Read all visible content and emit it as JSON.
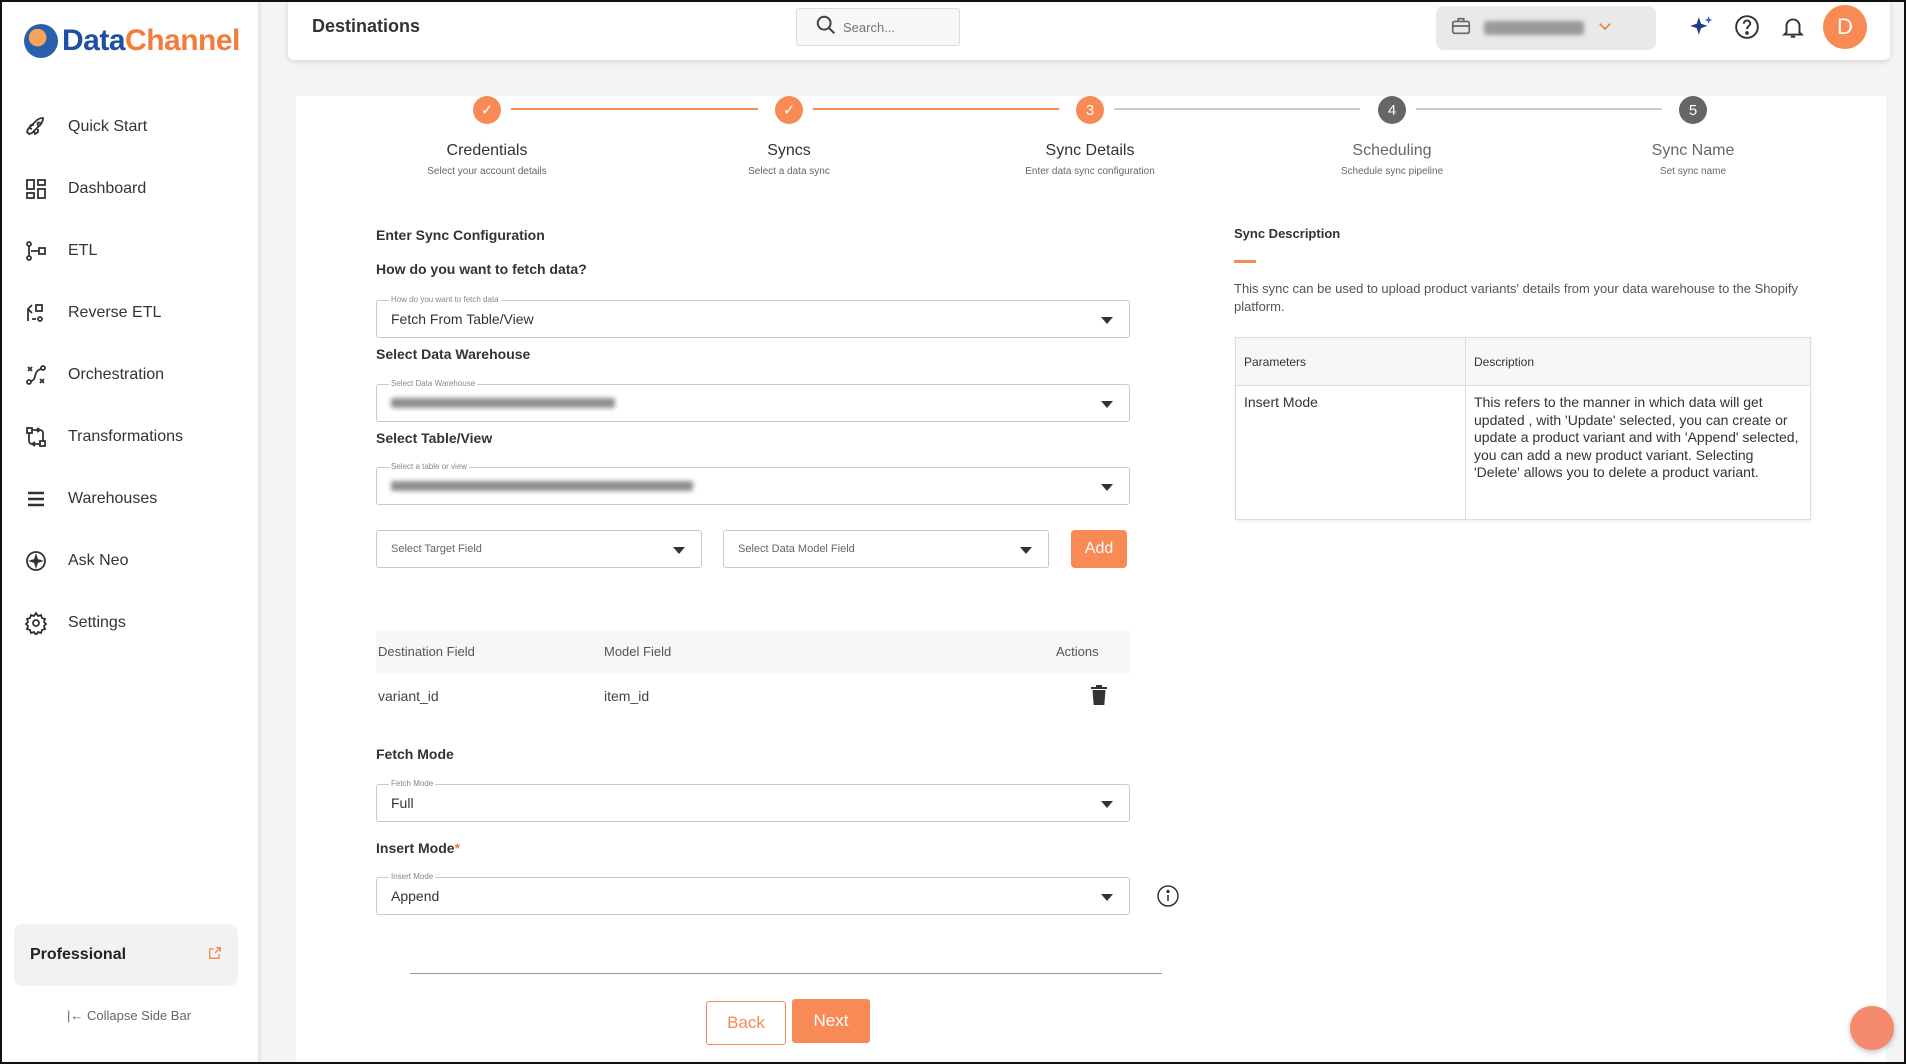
{
  "brand": {
    "part1": "Data",
    "part2": "Channel"
  },
  "sidebar": {
    "items": [
      {
        "label": "Quick Start",
        "icon": "rocket-icon"
      },
      {
        "label": "Dashboard",
        "icon": "dashboard-icon"
      },
      {
        "label": "ETL",
        "icon": "etl-icon"
      },
      {
        "label": "Reverse ETL",
        "icon": "reverse-etl-icon"
      },
      {
        "label": "Orchestration",
        "icon": "orchestration-icon"
      },
      {
        "label": "Transformations",
        "icon": "transformations-icon"
      },
      {
        "label": "Warehouses",
        "icon": "warehouses-icon"
      },
      {
        "label": "Ask Neo",
        "icon": "ask-neo-icon"
      },
      {
        "label": "Settings",
        "icon": "settings-icon"
      }
    ],
    "plan": "Professional",
    "collapse_label": "Collapse Side Bar"
  },
  "header": {
    "title": "Destinations",
    "search_placeholder": "Search...",
    "avatar_initial": "D"
  },
  "colors": {
    "accent": "#f78a55",
    "step_pending": "#666666",
    "brand_blue": "#1f4fa3"
  },
  "stepper": {
    "steps": [
      {
        "title": "Credentials",
        "subtitle": "Select your account details",
        "status": "done"
      },
      {
        "title": "Syncs",
        "subtitle": "Select a data sync",
        "status": "done"
      },
      {
        "title": "Sync Details",
        "subtitle": "Enter data sync configuration",
        "status": "active",
        "number": "3"
      },
      {
        "title": "Scheduling",
        "subtitle": "Schedule sync pipeline",
        "status": "pending",
        "number": "4"
      },
      {
        "title": "Sync Name",
        "subtitle": "Set sync name",
        "status": "pending",
        "number": "5"
      }
    ]
  },
  "form": {
    "heading": "Enter Sync Configuration",
    "fetch_question": "How do you want to fetch data?",
    "fetch_float": "How do you want to fetch data",
    "fetch_value": "Fetch From Table/View",
    "warehouse_label": "Select Data Warehouse",
    "warehouse_float": "Select Data Warehouse",
    "table_label": "Select Table/View",
    "table_float": "Select a table or view",
    "target_placeholder": "Select Target Field",
    "model_placeholder": "Select Data Model Field",
    "add_label": "Add",
    "mapping": {
      "headers": [
        "Destination Field",
        "Model Field",
        "Actions"
      ],
      "rows": [
        {
          "destination": "variant_id",
          "model": "item_id"
        }
      ]
    },
    "fetch_mode_label": "Fetch Mode",
    "fetch_mode_float": "Fetch Mode",
    "fetch_mode_value": "Full",
    "insert_mode_label": "Insert Mode",
    "insert_mode_required": "*",
    "insert_mode_float": "Insert Mode",
    "insert_mode_value": "Append",
    "back_label": "Back",
    "next_label": "Next"
  },
  "description": {
    "heading": "Sync Description",
    "text": "This sync can be used to upload product variants' details from your data warehouse to the Shopify platform.",
    "table_headers": [
      "Parameters",
      "Description"
    ],
    "rows": [
      {
        "parameter": "Insert Mode",
        "description": "This refers to the manner in which data will get updated , with 'Update' selected, you can create or update a product variant and with 'Append' selected, you can add a new product variant. Selecting 'Delete' allows you to delete a product variant."
      }
    ]
  }
}
